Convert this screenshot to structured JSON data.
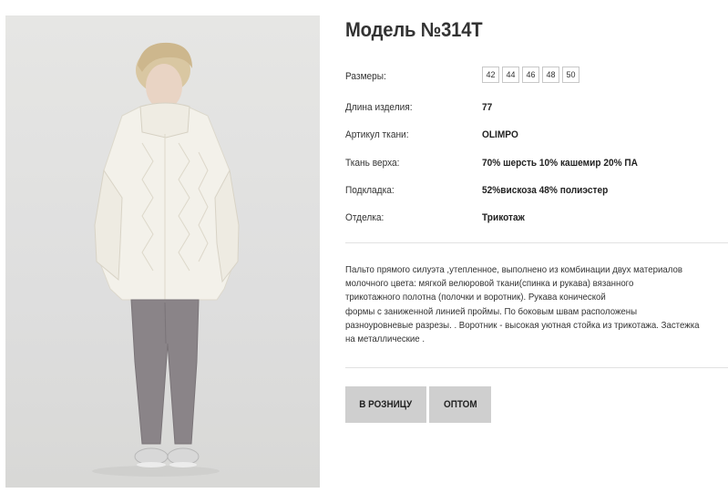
{
  "product": {
    "title": "Модель №314T"
  },
  "specs": {
    "sizes_label": "Размеры:",
    "sizes": [
      "42",
      "44",
      "46",
      "48",
      "50"
    ],
    "length_label": "Длина изделия:",
    "length_value": "77",
    "fabric_code_label": "Артикул ткани:",
    "fabric_code_value": "OLIMPO",
    "top_fabric_label": "Ткань верха:",
    "top_fabric_value": "70% шерсть 10% кашемир 20% ПА",
    "lining_label": "Подкладка:",
    "lining_value": "52%вискоза 48% полиэстер",
    "finish_label": "Отделка:",
    "finish_value": "Трикотаж"
  },
  "description": {
    "lines": [
      "Пальто прямого силуэта ,утепленное, выполнено из комбинации двух материалов",
      "молочного цвета: мягкой велюровой ткани(спинка и рукава)  вязанного",
      "трикотажного  полотна (полочки и воротник).  Рукава  конической",
      "формы  с  заниженной линией проймы.  По боковым швам расположены",
      "разноуровневые разрезы. . Воротник - высокая уютная стойка из трикотажа. Застежка",
      "на металлические ."
    ]
  },
  "actions": {
    "retail_label": "В РОЗНИЦУ",
    "wholesale_label": "ОПТОМ"
  },
  "colors": {
    "button_bg": "#cfcfcf",
    "photo_bg": "#e0e0de",
    "coat": "#f3f1ea",
    "trousers": "#8a8488"
  }
}
